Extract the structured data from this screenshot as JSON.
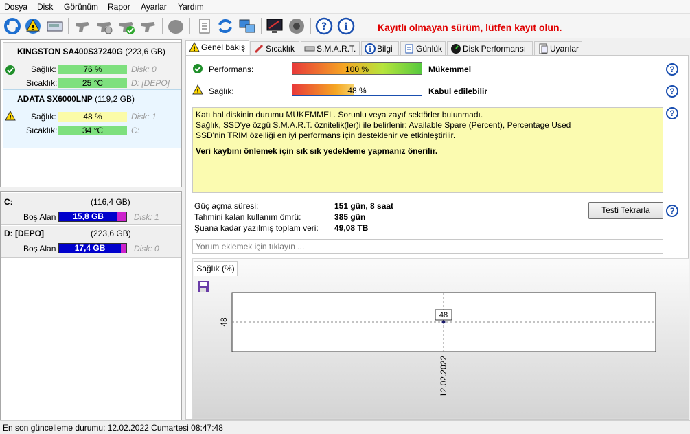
{
  "menu": [
    "Dosya",
    "Disk",
    "Görünüm",
    "Rapor",
    "Ayarlar",
    "Yardım"
  ],
  "toolbar": {
    "register_text": "Kayıtlı olmayan sürüm, lütfen kayıt olun.",
    "icons": [
      "refresh-icon",
      "alert-icon",
      "drive-icon",
      "gun-icon",
      "drive-gear-icon",
      "drive-check-icon",
      "gun-2-icon",
      "blob-icon",
      "notepad-icon",
      "sync-icon",
      "network-icon",
      "monitor-icon",
      "speaker-icon",
      "help-icon",
      "info-icon"
    ]
  },
  "disks": [
    {
      "name": "KINGSTON SA400S37240G",
      "size": "(223,6 GB)",
      "health_label": "Sağlık:",
      "health": "76 %",
      "health_pct": 76,
      "temp_label": "Sıcaklık:",
      "temp": "25 °C",
      "disk_no": "Disk: 0",
      "drive": "D: [DEPO]",
      "status_icon": "check-icon"
    },
    {
      "name": "ADATA SX6000LNP",
      "size": "(119,2 GB)",
      "health_label": "Sağlık:",
      "health": "48 %",
      "health_pct": 48,
      "temp_label": "Sıcaklık:",
      "temp": "34 °C",
      "disk_no": "Disk: 1",
      "drive": "C:",
      "status_icon": "warning-icon"
    }
  ],
  "volumes": [
    {
      "name": "C:",
      "size": "(116,4 GB)",
      "free_label": "Boş Alan",
      "free": "15,8 GB",
      "disk": "Disk: 1",
      "used_pct": 87
    },
    {
      "name": "D: [DEPO]",
      "size": "(223,6 GB)",
      "free_label": "Boş Alan",
      "free": "17,4 GB",
      "disk": "Disk: 0",
      "used_pct": 92
    }
  ],
  "tabs": [
    "Genel bakış",
    "Sıcaklık",
    "S.M.A.R.T.",
    "Bilgi",
    "Günlük",
    "Disk Performansı",
    "Uyarılar"
  ],
  "overview": {
    "performance_label": "Performans:",
    "performance": "100 %",
    "performance_pct": 100,
    "performance_status": "Mükemmel",
    "health_label": "Sağlık:",
    "health": "48 %",
    "health_pct": 48,
    "health_status": "Kabul edilebilir",
    "message_lines": [
      "Katı hal diskinin durumu MÜKEMMEL. Sorunlu veya zayıf sektörler bulunmadı.",
      "Sağlık, SSD'ye özgü S.M.A.R.T. öznitelik(ler)i ile belirlenir:  Available Spare (Percent), Percentage Used",
      "SSD'nin TRIM özelliği en iyi performans için desteklenir ve etkinleştirilir."
    ],
    "message_bold": "Veri kaybını önlemek için sık sık yedekleme yapmanız önerilir.",
    "power_on_label": "Güç açma süresi:",
    "power_on": "151 gün, 8 saat",
    "remaining_label": "Tahmini kalan kullanım ömrü:",
    "remaining": "385 gün",
    "written_label": "Şuana kadar yazılmış toplam veri:",
    "written": "49,08 TB",
    "retest_button": "Testi Tekrarla",
    "comment_placeholder": "Yorum eklemek için tıklayın ..."
  },
  "chart_tab": "Sağlık (%)",
  "chart_data": {
    "type": "line",
    "series": [
      {
        "x": [
          "12.02.2022"
        ],
        "values": [
          48
        ]
      }
    ],
    "x_ticks": [
      "12.02.2022"
    ],
    "y_ticks": [
      "48"
    ],
    "point_label": "48"
  },
  "status_bar": "En son güncelleme durumu: 12.02.2022 Cumartesi 08:47:48",
  "colors": {
    "link_red": "#e00000",
    "selected_card": "#eaf6ff",
    "green_bar": "#7ee07e",
    "yellow_bar": "#fbfba8",
    "blue_bar": "#0000cc"
  }
}
